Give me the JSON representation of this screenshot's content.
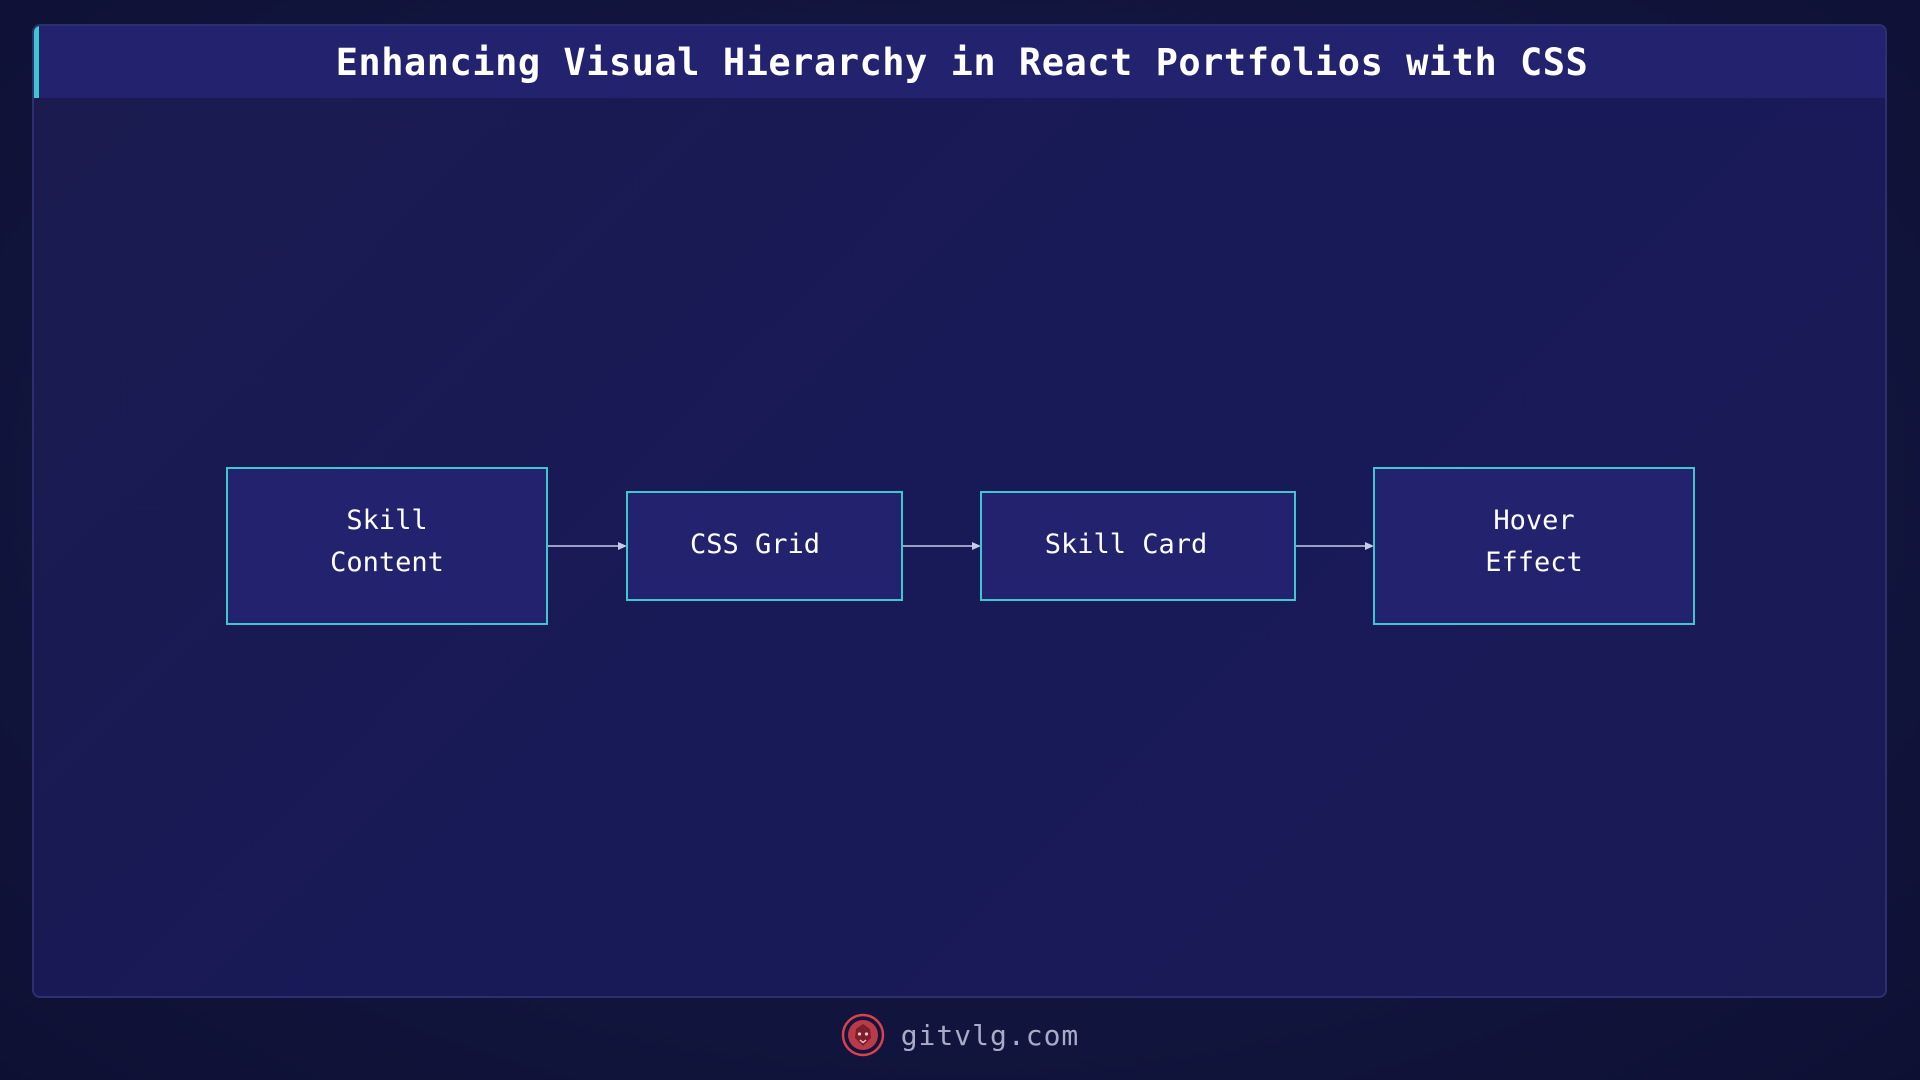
{
  "header": {
    "title": "Enhancing Visual Hierarchy in React Portfolios with CSS"
  },
  "diagram": {
    "nodes": [
      {
        "id": "skill-content",
        "lines": [
          "Skill",
          "Content"
        ]
      },
      {
        "id": "css-grid",
        "lines": [
          "CSS Grid"
        ]
      },
      {
        "id": "skill-card",
        "lines": [
          "Skill Card"
        ]
      },
      {
        "id": "hover-effect",
        "lines": [
          "Hover",
          "Effect"
        ]
      }
    ],
    "edges": [
      {
        "from": "skill-content",
        "to": "css-grid"
      },
      {
        "from": "css-grid",
        "to": "skill-card"
      },
      {
        "from": "skill-card",
        "to": "hover-effect"
      }
    ]
  },
  "footer": {
    "logo_icon": "lion-head-icon",
    "site": "gitvlg.com"
  },
  "colors": {
    "background": "#111338",
    "panel": "#1a1a52",
    "header": "#23226f",
    "accent": "#3fc6cf",
    "node_fill": "#23226f",
    "text": "#ffffff",
    "footer_text": "#a9abc6",
    "logo": "#d9414b"
  }
}
